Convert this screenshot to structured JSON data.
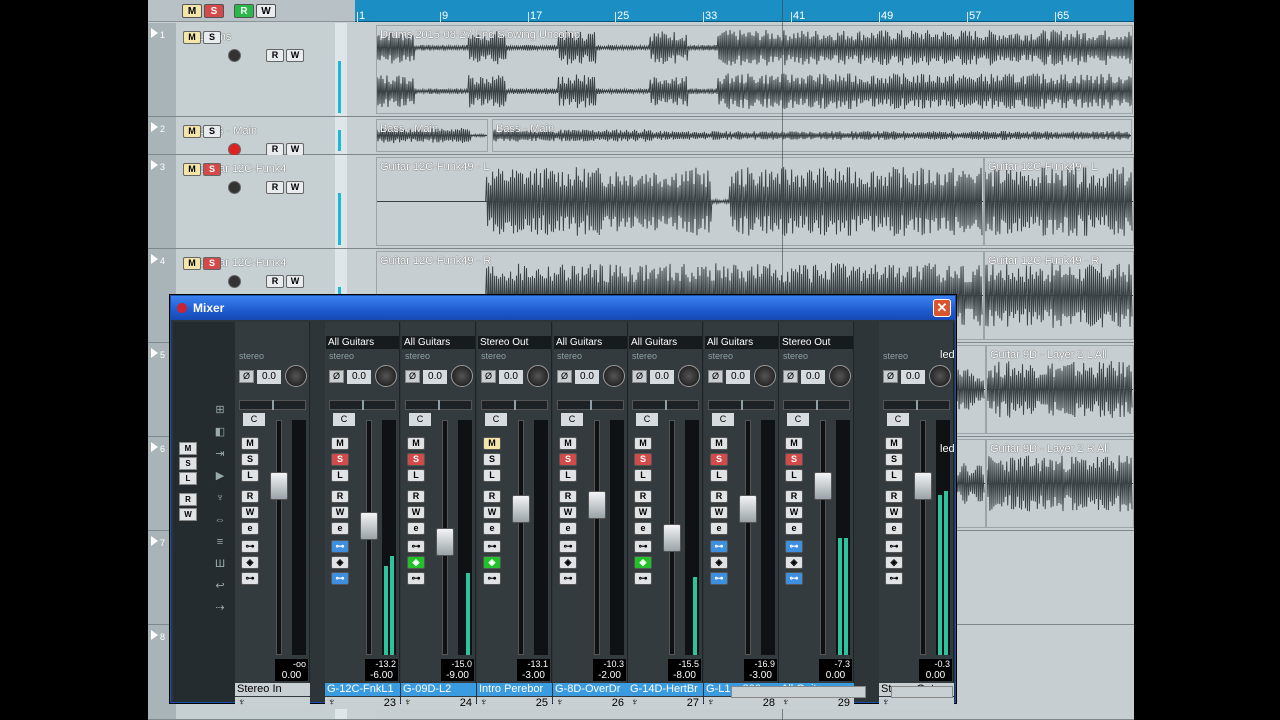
{
  "global_buttons": {
    "m": "M",
    "s": "S",
    "r": "R",
    "w": "W"
  },
  "ruler": {
    "marks": [
      "1",
      "9",
      "17",
      "25",
      "33",
      "41",
      "49",
      "57",
      "65"
    ]
  },
  "tracks": [
    {
      "num": "1",
      "name": "Drums",
      "clips": [
        {
          "name": "Drums 2015-08-27 End Slowing Uncomp"
        }
      ]
    },
    {
      "num": "2",
      "name": "Bass - Main",
      "clips": [
        {
          "name": "Bass - Main"
        },
        {
          "name": "Bass - Main"
        }
      ]
    },
    {
      "num": "3",
      "name": "Guitar 12C-Funk4",
      "clips": [
        {
          "name": "Guitar 12C-Funk49 - L"
        },
        {
          "name": "Guitar 12C-Funk49 - L"
        }
      ]
    },
    {
      "num": "4",
      "name": "Guitar 12C-Funk4",
      "clips": [
        {
          "name": "Guitar 12C-Funk49 - R"
        },
        {
          "name": "Guitar 12C-Funk49 - R"
        }
      ]
    },
    {
      "num": "5",
      "clips": [
        {
          "name": "led"
        },
        {
          "name": "Guitar 9D - Layer 2 L All"
        }
      ]
    },
    {
      "num": "6",
      "clips": [
        {
          "name": "led"
        },
        {
          "name": "Guitar 9D - Layer 2 R All"
        }
      ]
    },
    {
      "num": "7",
      "clips": []
    },
    {
      "num": "8",
      "clips": []
    }
  ],
  "button_labels": {
    "m": "M",
    "s": "S",
    "r": "R",
    "w": "W",
    "e": "e",
    "l": "L",
    "c": "C",
    "phase": "Ø"
  },
  "mixer": {
    "title": "Mixer",
    "close": "✕",
    "left_panel": {
      "buttons": [
        "M",
        "S",
        "L",
        "R",
        "W"
      ]
    },
    "strips": [
      {
        "route": "",
        "stereo": "stereo",
        "gain": "0.0",
        "pan": "C",
        "meter_peak": "-oo",
        "fader": "0.00",
        "name": "Stereo In",
        "num": "",
        "fader_pos": 0.72,
        "meter": [
          0,
          0
        ],
        "solo": false,
        "mon": false,
        "blue": false,
        "green": false
      },
      {
        "route": "All Guitars",
        "stereo": "stereo",
        "gain": "0.0",
        "pan": "C",
        "meter_peak": "-13.2",
        "fader": "-6.00",
        "name": "G-12C-FnkL1",
        "num": "23",
        "fader_pos": 0.55,
        "meter": [
          0.38,
          0.42
        ],
        "solo": true,
        "mon": false,
        "blue": true,
        "green": false
      },
      {
        "route": "All Guitars",
        "stereo": "stereo",
        "gain": "0.0",
        "pan": "C",
        "meter_peak": "-15.0",
        "fader": "-9.00",
        "name": "G-09D-L2",
        "num": "24",
        "fader_pos": 0.48,
        "meter": [
          0,
          0.35
        ],
        "solo": true,
        "mon": false,
        "blue": false,
        "green": true
      },
      {
        "route": "Stereo Out",
        "stereo": "stereo",
        "gain": "0.0",
        "pan": "C",
        "meter_peak": "-13.1",
        "fader": "-3.00",
        "name": "Intro Perebor",
        "num": "25",
        "fader_pos": 0.62,
        "meter": [
          0,
          0
        ],
        "solo": false,
        "mon": true,
        "blue": false,
        "green": true
      },
      {
        "route": "All Guitars",
        "stereo": "stereo",
        "gain": "0.0",
        "pan": "C",
        "meter_peak": "-10.3",
        "fader": "-2.00",
        "name": "G-8D-OverDr",
        "num": "26",
        "fader_pos": 0.64,
        "meter": [
          0,
          0
        ],
        "solo": true,
        "mon": false,
        "blue": false,
        "green": false
      },
      {
        "route": "All Guitars",
        "stereo": "stereo",
        "gain": "0.0",
        "pan": "C",
        "meter_peak": "-15.5",
        "fader": "-8.00",
        "name": "G-14D-HertBr",
        "num": "27",
        "fader_pos": 0.5,
        "meter": [
          0,
          0.33
        ],
        "solo": true,
        "mon": false,
        "blue": false,
        "green": true
      },
      {
        "route": "All Guitars",
        "stereo": "stereo",
        "gain": "0.0",
        "pan": "C",
        "meter_peak": "-16.9",
        "fader": "-3.00",
        "name": "G-L1....800",
        "num": "28",
        "fader_pos": 0.62,
        "meter": [
          0,
          0
        ],
        "solo": true,
        "mon": false,
        "blue": true,
        "green": false
      },
      {
        "route": "Stereo Out",
        "stereo": "stereo",
        "gain": "0.0",
        "pan": "C",
        "meter_peak": "-7.3",
        "fader": "0.00",
        "name": "All Guitars",
        "num": "29",
        "fader_pos": 0.72,
        "meter": [
          0.5,
          0.5
        ],
        "solo": true,
        "mon": false,
        "blue": true,
        "green": false
      },
      {
        "route": "",
        "stereo": "stereo",
        "gain": "0.0",
        "pan": "C",
        "meter_peak": "-0.3",
        "fader": "0.00",
        "name": "Stereo Out",
        "num": "",
        "fader_pos": 0.72,
        "meter": [
          0.68,
          0.7
        ],
        "solo": false,
        "mon": false,
        "blue": false,
        "green": false
      }
    ]
  }
}
